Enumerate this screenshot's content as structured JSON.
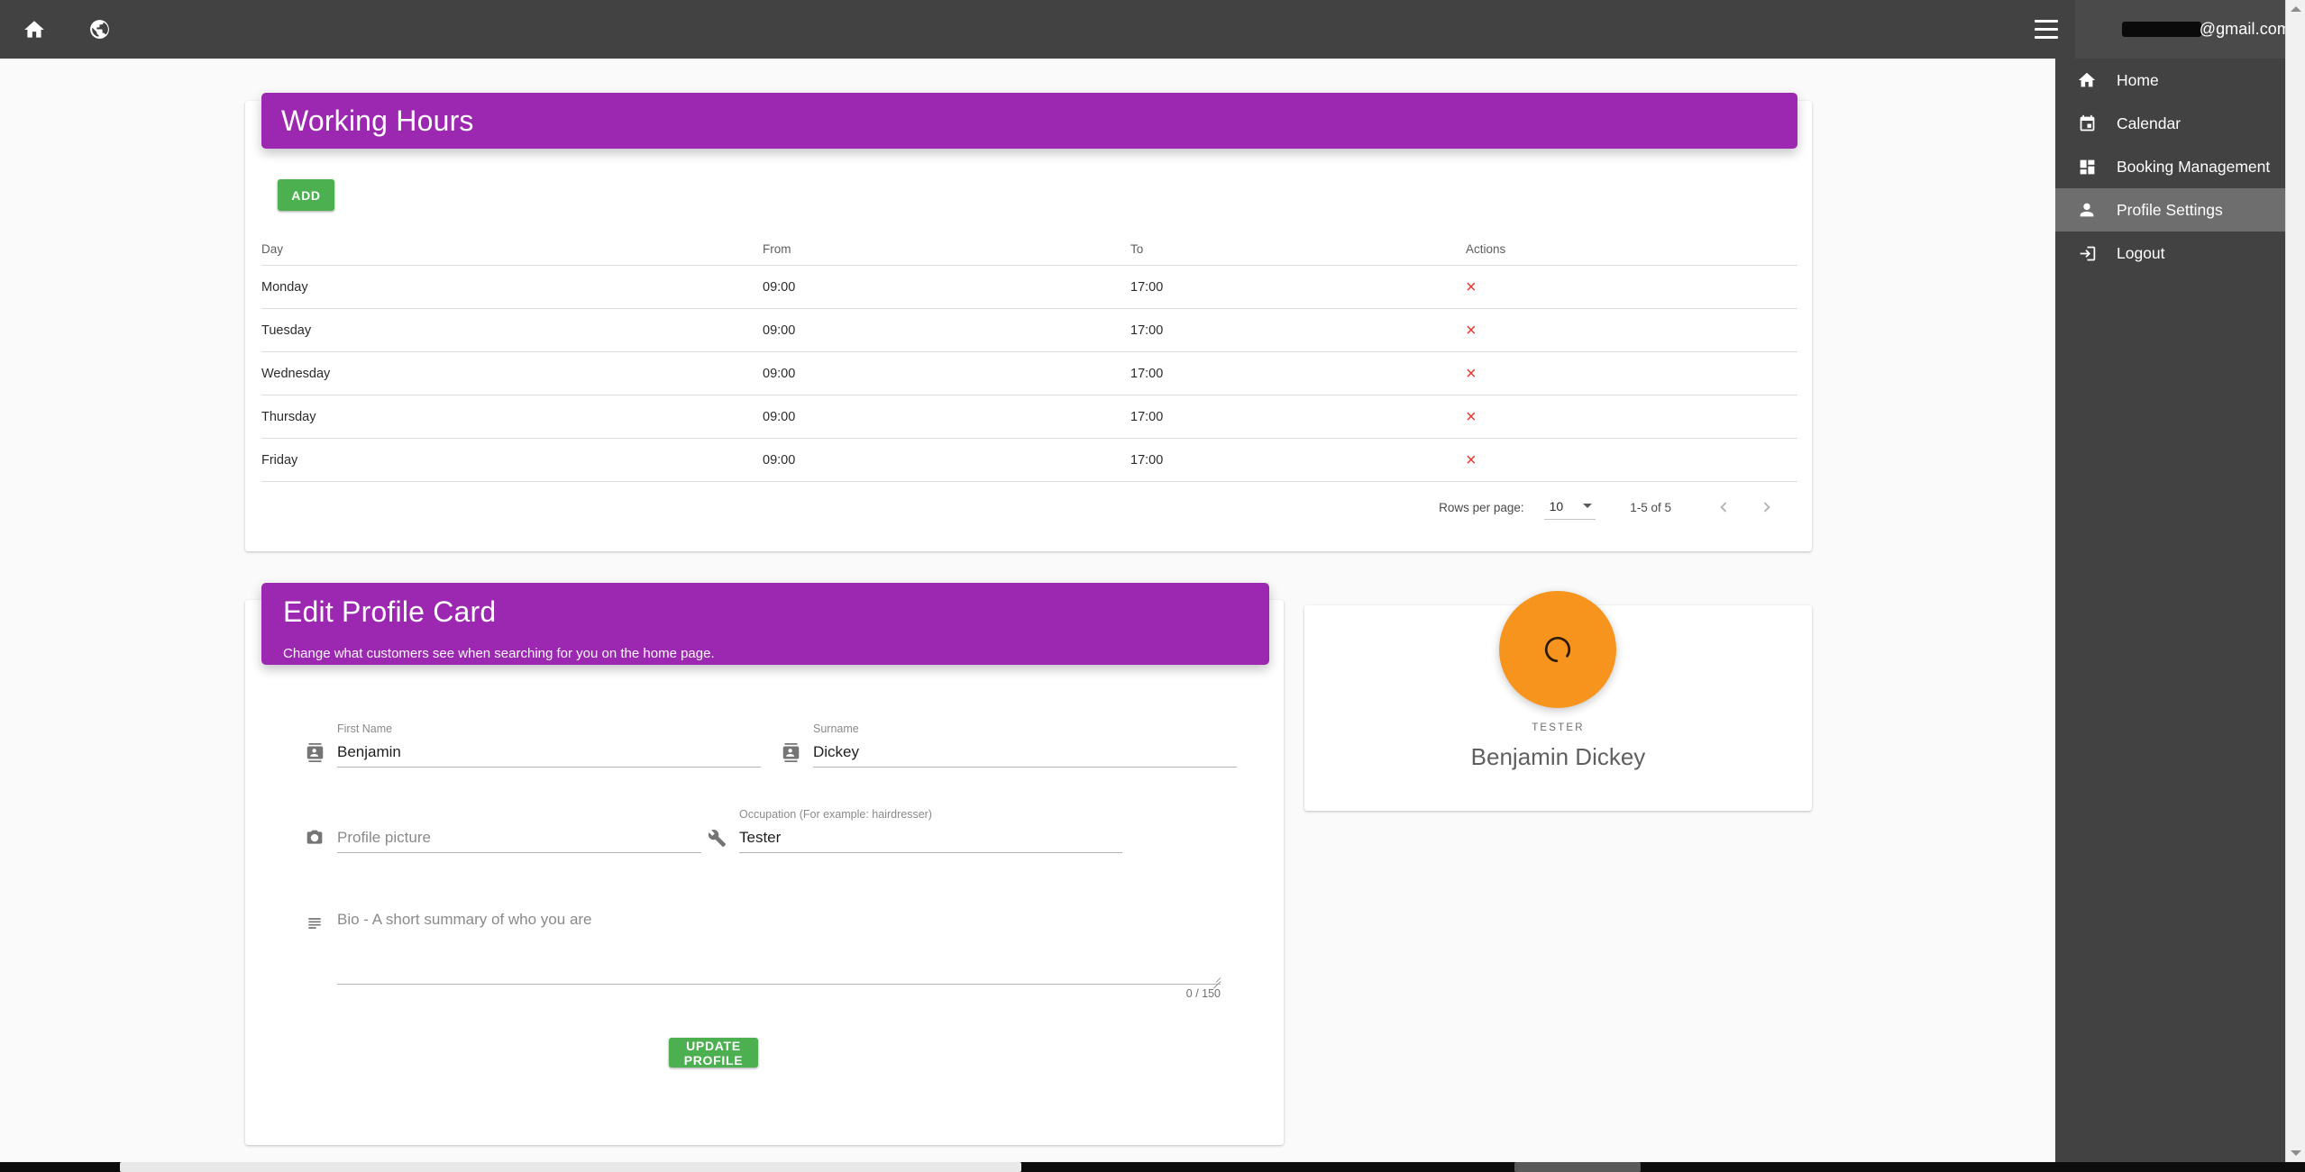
{
  "topbar": {
    "home_icon": "home-icon",
    "globe_icon": "public-globe-icon",
    "menu_icon": "hamburger-menu-icon",
    "account_email_suffix": "@gmail.com"
  },
  "side_menu": {
    "items": [
      {
        "label": "Home",
        "icon": "home-icon",
        "active": false
      },
      {
        "label": "Calendar",
        "icon": "calendar-icon",
        "active": false
      },
      {
        "label": "Booking Management",
        "icon": "dashboard-icon",
        "active": false
      },
      {
        "label": "Profile Settings",
        "icon": "person-icon",
        "active": true
      },
      {
        "label": "Logout",
        "icon": "logout-icon",
        "active": false
      }
    ]
  },
  "working_hours": {
    "title": "Working Hours",
    "add_button": "ADD",
    "columns": [
      "Day",
      "From",
      "To",
      "Actions"
    ],
    "rows": [
      {
        "day": "Monday",
        "from": "09:00",
        "to": "17:00",
        "action": "×"
      },
      {
        "day": "Tuesday",
        "from": "09:00",
        "to": "17:00",
        "action": "×"
      },
      {
        "day": "Wednesday",
        "from": "09:00",
        "to": "17:00",
        "action": "×"
      },
      {
        "day": "Thursday",
        "from": "09:00",
        "to": "17:00",
        "action": "×"
      },
      {
        "day": "Friday",
        "from": "09:00",
        "to": "17:00",
        "action": "×"
      }
    ],
    "paginator": {
      "rows_per_page_label": "Rows per page:",
      "rows_per_page_value": "10",
      "range_label": "1-5 of 5"
    }
  },
  "edit_profile": {
    "title": "Edit Profile Card",
    "subtitle": "Change what customers see when searching for you on the home page.",
    "fields": {
      "first_name": {
        "label": "First Name",
        "value": "Benjamin",
        "icon": "contact-person-icon"
      },
      "surname": {
        "label": "Surname",
        "value": "Dickey",
        "icon": "contact-person-icon"
      },
      "profile_picture": {
        "placeholder": "Profile picture",
        "value": "",
        "icon": "camera-icon"
      },
      "occupation": {
        "label": "Occupation (For example: hairdresser)",
        "value": "Tester",
        "icon": "build-wrench-icon"
      },
      "bio": {
        "placeholder": "Bio - A short summary of who you are",
        "value": "",
        "icon": "subject-notes-icon"
      }
    },
    "char_count": "0 / 150",
    "update_button": "UPDATE PROFILE"
  },
  "profile_preview": {
    "avatar_icon": "loading-spinner-icon",
    "role": "TESTER",
    "name": "Benjamin Dickey"
  },
  "colors": {
    "purple": "#9c27b0",
    "green": "#4caf50",
    "topbar_dark": "#424242",
    "menu_active": "#6e6e6e",
    "avatar_orange": "#f7941e",
    "delete_red": "#e53935",
    "page_bg": "#fafafa"
  }
}
